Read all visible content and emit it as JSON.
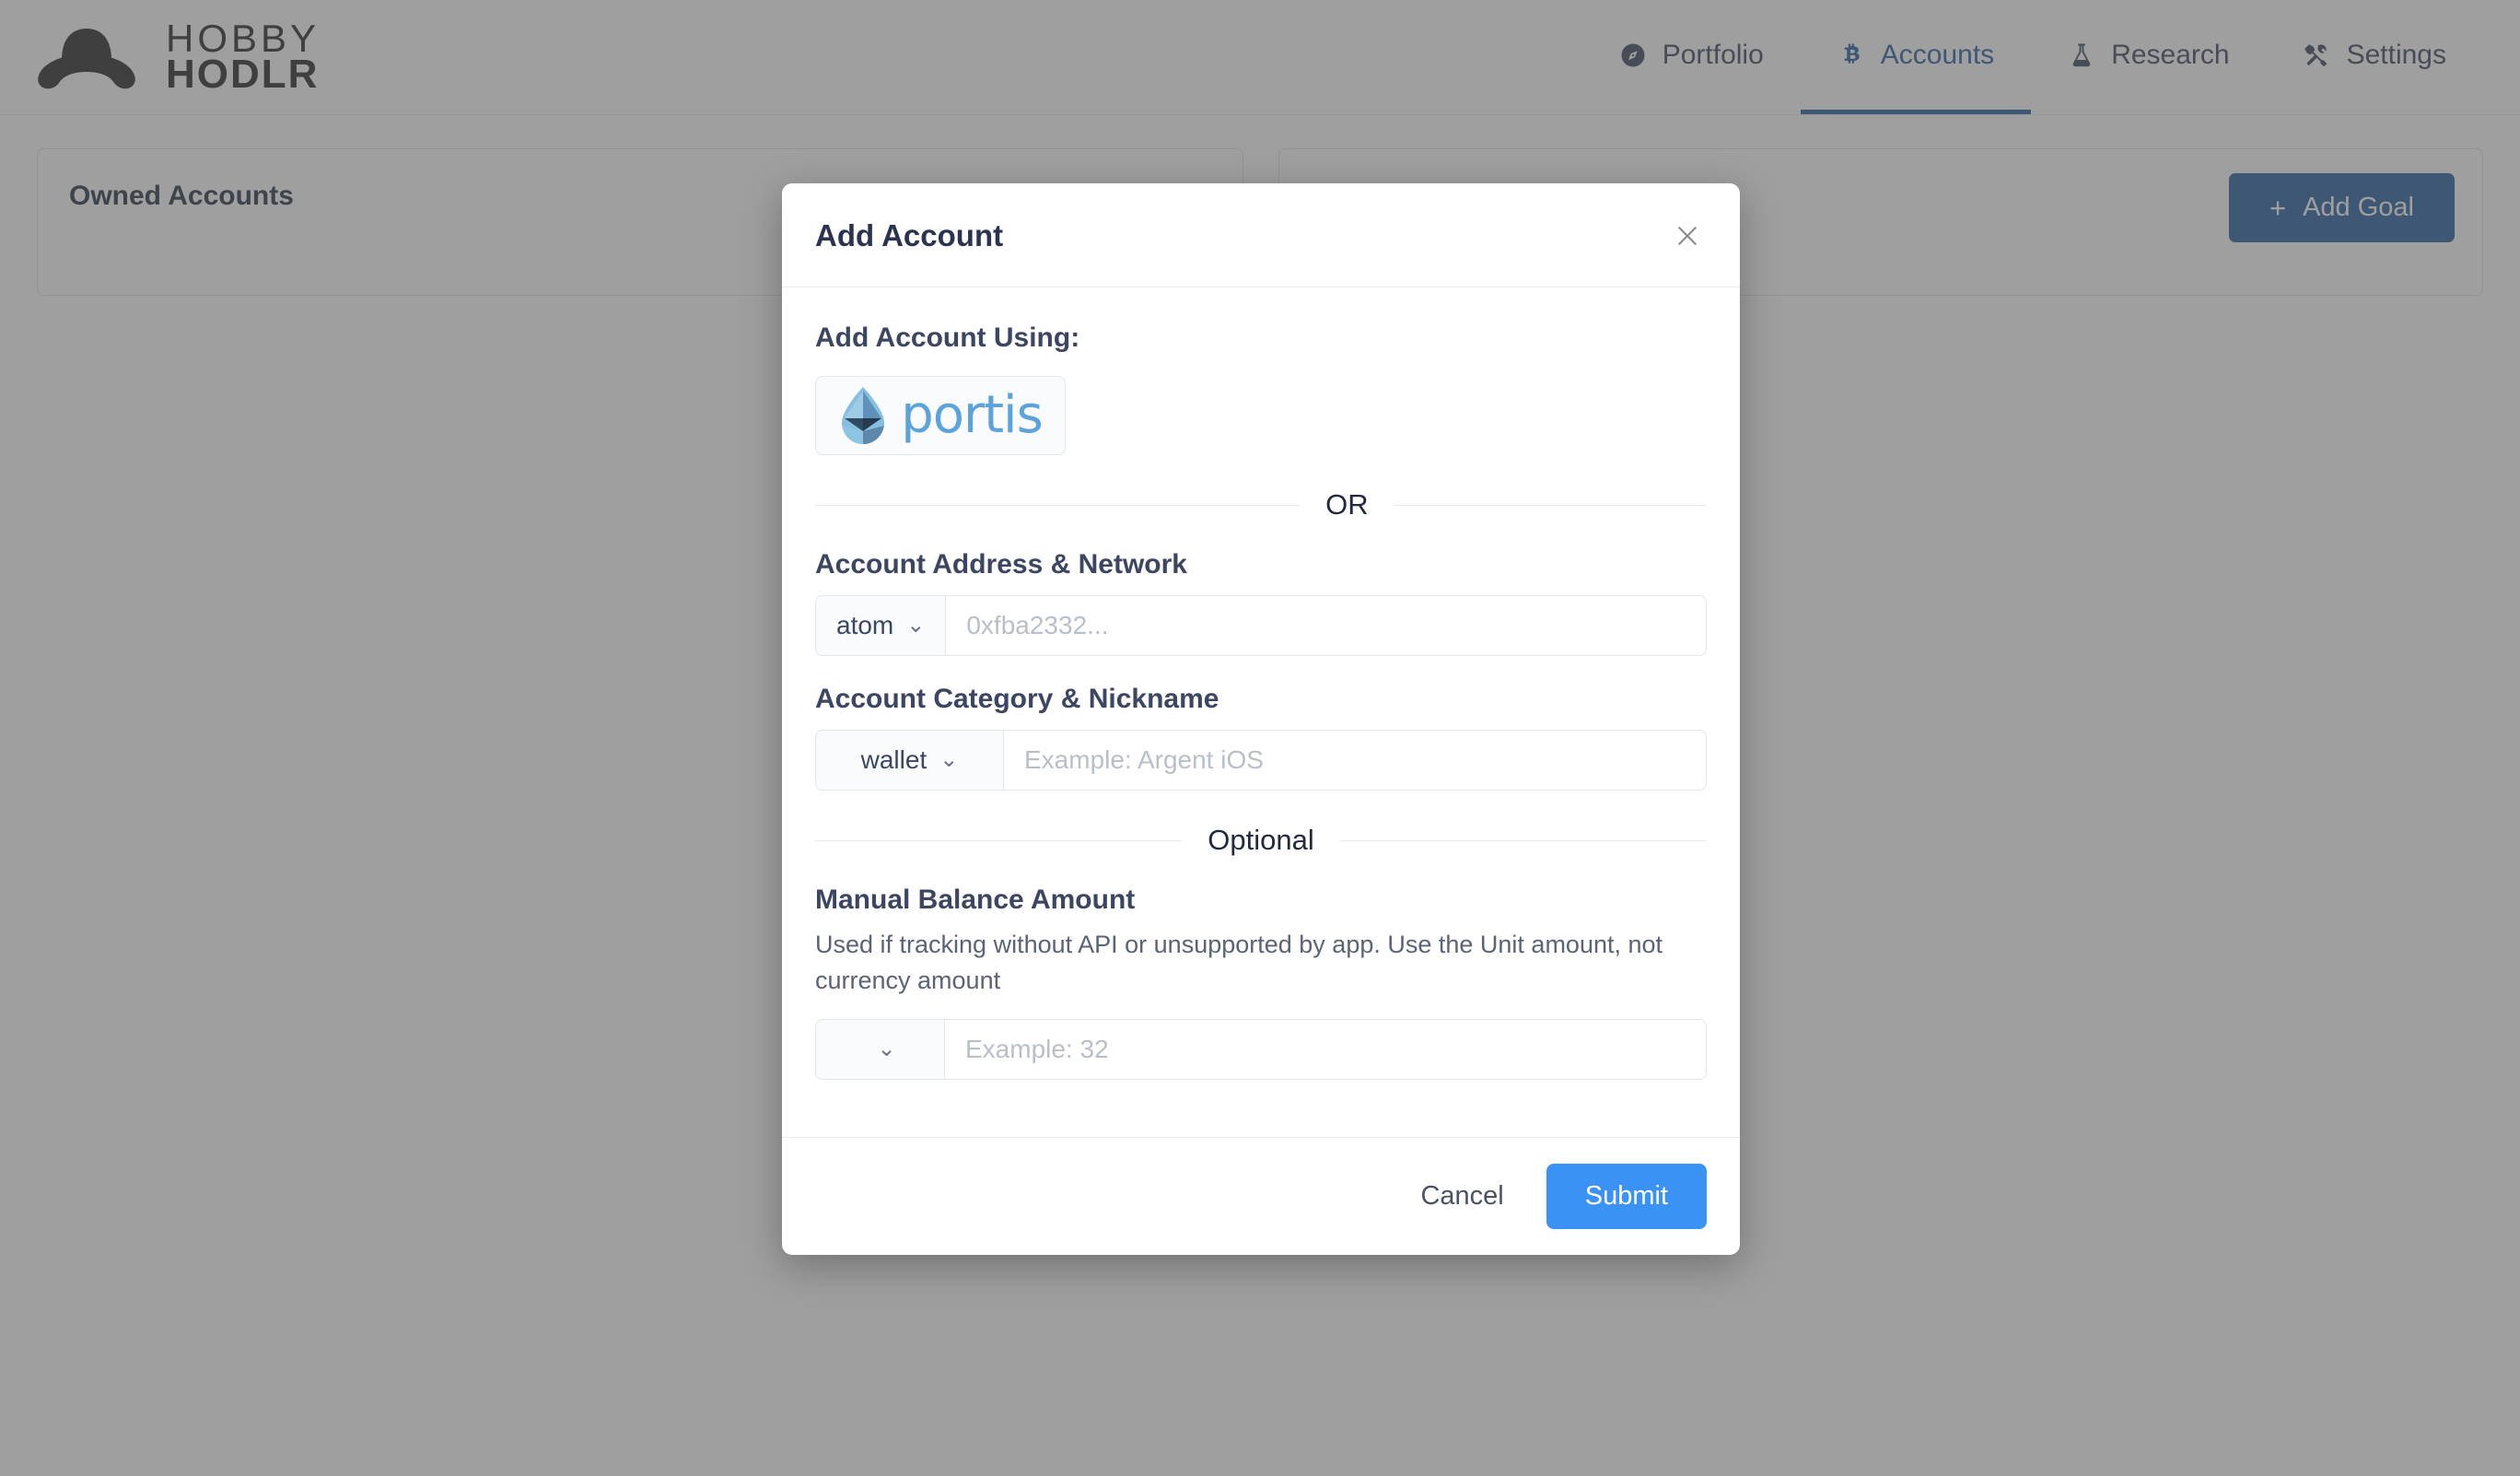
{
  "brand": {
    "line1": "HOBBY",
    "line2": "HODLR",
    "logo_icon": "bowler-hat-icon"
  },
  "nav": {
    "items": [
      {
        "label": "Portfolio",
        "icon": "compass-icon",
        "active": false
      },
      {
        "label": "Accounts",
        "icon": "bitcoin-icon",
        "active": true
      },
      {
        "label": "Research",
        "icon": "flask-icon",
        "active": false
      },
      {
        "label": "Settings",
        "icon": "tools-icon",
        "active": false
      }
    ]
  },
  "page": {
    "owned_accounts_title": "Owned Accounts",
    "add_goal_label": "Add Goal",
    "add_goal_plus": "+"
  },
  "modal": {
    "title": "Add Account",
    "close_icon": "close-icon",
    "add_using_label": "Add Account Using:",
    "portis": {
      "label": "portis",
      "icon": "portis-droplet-icon"
    },
    "or_divider": "OR",
    "address_section": {
      "label": "Account Address & Network",
      "network_value": "atom",
      "address_placeholder": "0xfba2332...",
      "address_value": ""
    },
    "category_section": {
      "label": "Account Category & Nickname",
      "category_value": "wallet",
      "nickname_placeholder": "Example: Argent iOS",
      "nickname_value": ""
    },
    "optional_divider": "Optional",
    "manual_balance": {
      "heading": "Manual Balance Amount",
      "description": "Used if tracking without API or unsupported by app. Use the Unit amount, not currency amount",
      "unit_value": "",
      "amount_placeholder": "Example: 32",
      "amount_value": ""
    },
    "footer": {
      "cancel_label": "Cancel",
      "submit_label": "Submit"
    }
  },
  "colors": {
    "accent_blue": "#3b92f5",
    "nav_active": "#3b6fa8",
    "goal_button": "#3b6fa8",
    "portis_blue": "#5ba3d9",
    "text_dark": "#3c4663"
  }
}
